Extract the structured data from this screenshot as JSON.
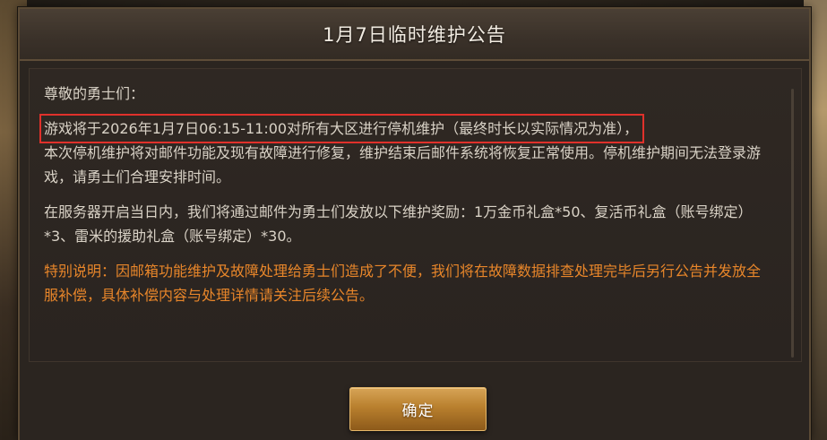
{
  "dialog": {
    "title": "1月7日临时维护公告",
    "greeting": "尊敬的勇士们：",
    "paragraph1_highlight": "游戏将于2026年1月7日06:15-11:00对所有大区进行停机维护（最终时长以实际情况为准），",
    "paragraph1_rest": "本次停机维护将对邮件功能及现有故障进行修复，维护结束后邮件系统将恢复正常使用。停机维护期间无法登录游戏，请勇士们合理安排时间。",
    "paragraph2": "在服务器开启当日内，我们将通过邮件为勇士们发放以下维护奖励：1万金币礼盒*50、复活币礼盒（账号绑定）*3、雷米的援助礼盒（账号绑定）*30。",
    "paragraph3": "特别说明：因邮箱功能维护及故障处理给勇士们造成了不便，我们将在故障数据排查处理完毕后另行公告并发放全服补偿，具体补偿内容与处理详情请关注后续公告。",
    "confirm_label": "确定"
  },
  "colors": {
    "highlight_border": "#e0312b",
    "special_text": "#e8862a",
    "button": "#b9802e"
  }
}
